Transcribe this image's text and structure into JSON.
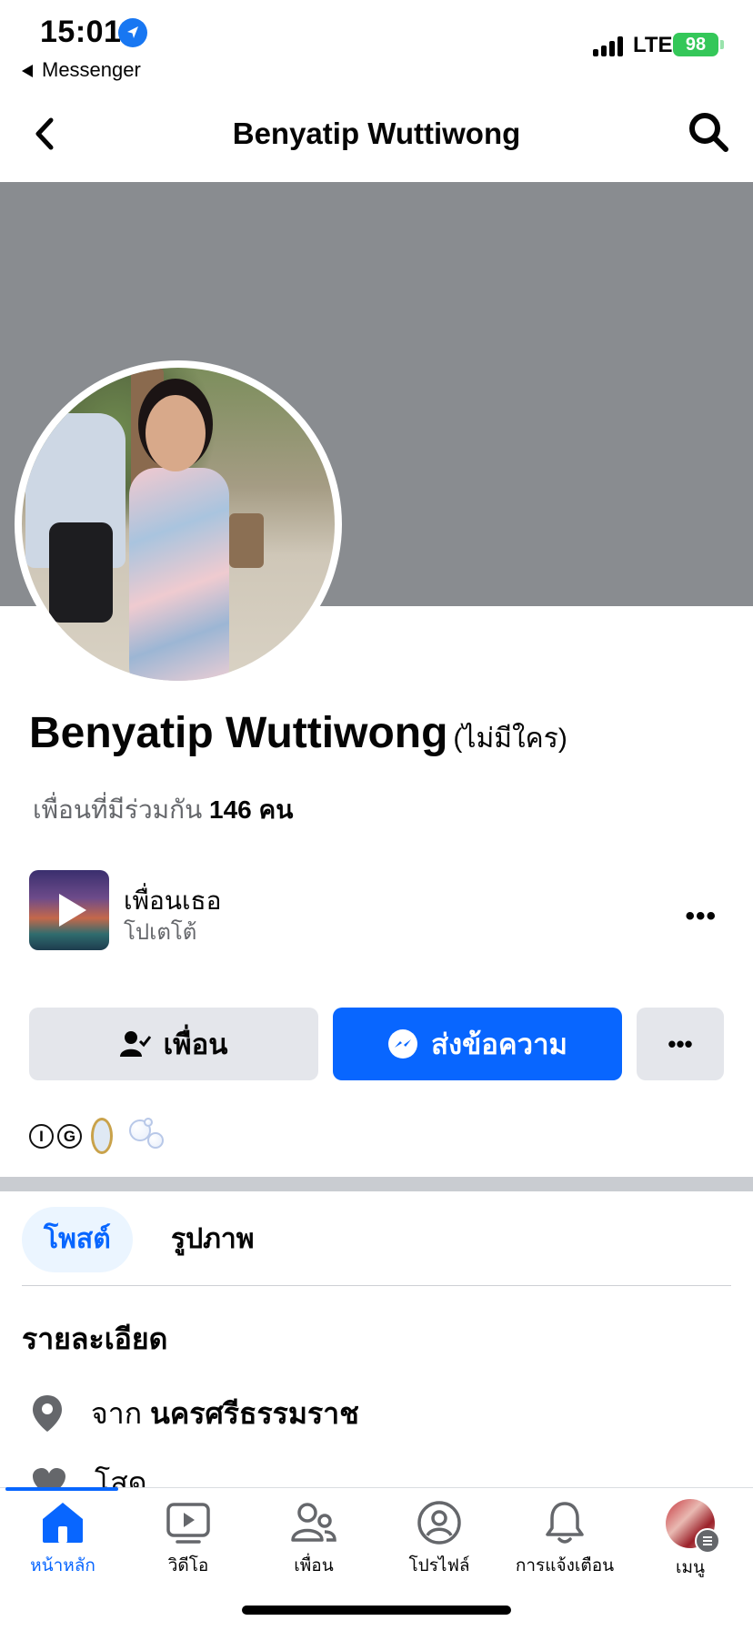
{
  "status_bar": {
    "time": "15:01",
    "back_app": "Messenger",
    "network": "LTE",
    "battery": "98",
    "colors": {
      "battery": "#34c759",
      "location": "#1877f2"
    }
  },
  "header": {
    "title": "Benyatip Wuttiwong",
    "back_icon": "chevron-left-icon",
    "search_icon": "search-icon"
  },
  "profile": {
    "name": "Benyatip Wuttiwong",
    "nickname": "(ไม่มีใคร)",
    "mutual_prefix": "เพื่อนที่มีร่วมกัน",
    "mutual_count": "146",
    "mutual_suffix": "คน"
  },
  "music": {
    "title": "เพื่อนเธอ",
    "subtitle": "โปเตโต้",
    "more": "•••"
  },
  "actions": {
    "friend_label": "เพื่อน",
    "message_label": "ส่งข้อความ",
    "more_label": "•••",
    "colors": {
      "primary": "#0866ff",
      "secondary": "#e4e6eb"
    }
  },
  "bio_emojis": {
    "i": "I",
    "g": "G"
  },
  "tabs": [
    {
      "label": "โพสต์",
      "active": true
    },
    {
      "label": "รูปภาพ",
      "active": false
    }
  ],
  "details": {
    "heading": "รายละเอียด",
    "from_prefix": "จาก",
    "from_place": "นครศรีธรรมราช",
    "status_partial": "โสด"
  },
  "bottom_nav": [
    {
      "label": "หน้าหลัก",
      "icon": "home-icon",
      "active": true
    },
    {
      "label": "วิดีโอ",
      "icon": "video-icon",
      "active": false
    },
    {
      "label": "เพื่อน",
      "icon": "friends-icon",
      "active": false
    },
    {
      "label": "โปรไฟล์",
      "icon": "profile-icon",
      "active": false
    },
    {
      "label": "การแจ้งเตือน",
      "icon": "bell-icon",
      "active": false
    },
    {
      "label": "เมนู",
      "icon": "menu-avatar-icon",
      "active": false
    }
  ]
}
